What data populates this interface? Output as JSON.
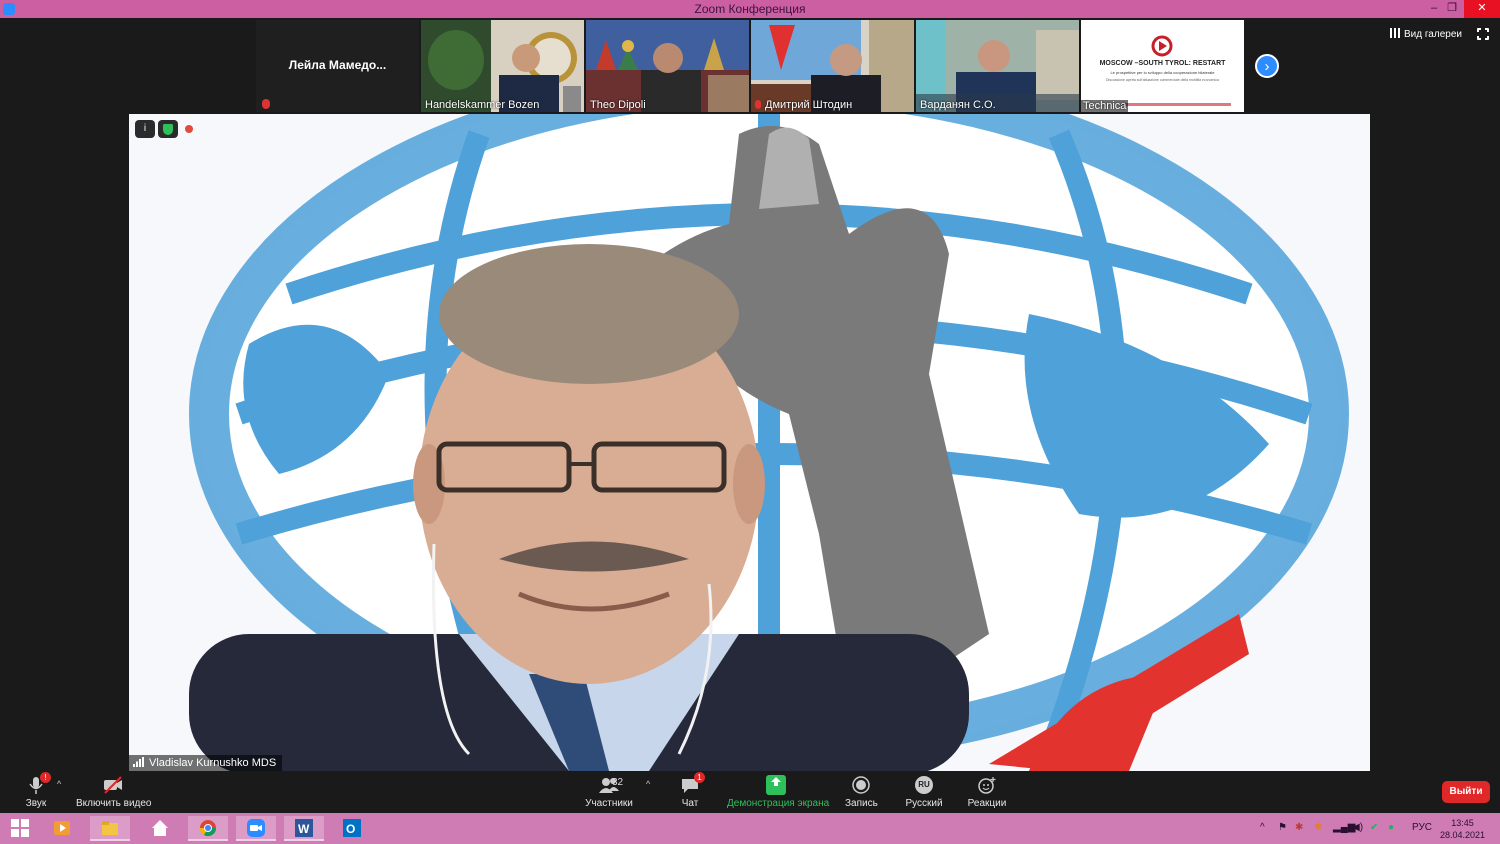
{
  "window": {
    "title": "Zoom Конференция",
    "minimize": "–",
    "restore": "❐",
    "close": "✕",
    "title_color": "#cc5fa1"
  },
  "gallery": {
    "view_label": "Вид галереи",
    "next_icon": "chevron-right-icon",
    "participants": [
      {
        "name": "Лейла  Мамедо...",
        "muted": true,
        "video": false
      },
      {
        "name": "Handelskammer Bozen",
        "muted": false,
        "video": true
      },
      {
        "name": "Theo Dipoli",
        "muted": false,
        "video": true
      },
      {
        "name": "Дмитрий Штодин",
        "muted": true,
        "video": true
      },
      {
        "name": "Варданян С.О.",
        "muted": false,
        "video": true
      },
      {
        "name": "Technica",
        "muted": false,
        "video": true
      }
    ],
    "slide": {
      "title": "MOSCOW –SOUTH TYROL: RESTART",
      "subtitle": "Le prospettive per lo sviluppo della cooperazione bilaterale",
      "tagline": "Discussione aperta sull'attuazione commerciale della mobilità economica"
    }
  },
  "main": {
    "speaker_name": "Vladislav Kurnushko MDS",
    "info_icon": "info-icon",
    "shield_icon": "shield-icon"
  },
  "toolbar": {
    "audio": "Звук",
    "video": "Включить видео",
    "participants": "Участники",
    "participants_count": "32",
    "chat": "Чат",
    "chat_badge": "1",
    "audio_badge": "!",
    "share": "Демонстрация экрана",
    "record": "Запись",
    "language": "Русский",
    "language_code": "RU",
    "reactions": "Реакции",
    "leave": "Выйти",
    "leave_color": "#e02828",
    "share_color": "#2ec05b"
  },
  "taskbar": {
    "language": "РУС",
    "time": "13:45",
    "date": "28.04.2021",
    "color": "#cf7cb4"
  }
}
